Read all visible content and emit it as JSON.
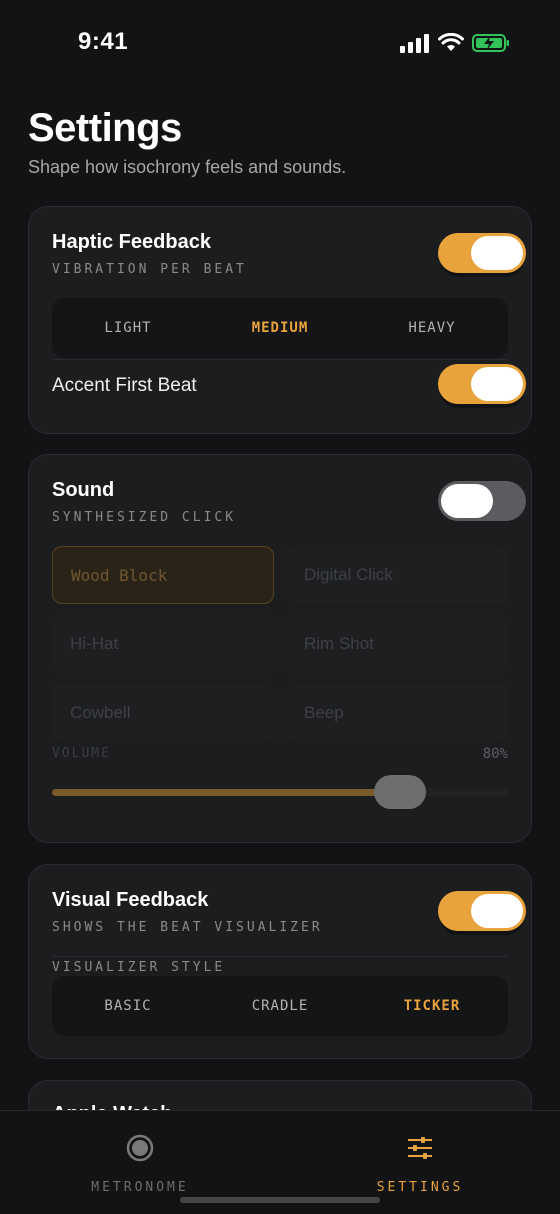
{
  "status": {
    "time": "9:41"
  },
  "header": {
    "title": "Settings",
    "subtitle": "Shape how isochrony feels and sounds."
  },
  "haptic": {
    "title": "Haptic Feedback",
    "caption": "VIBRATION PER BEAT",
    "enabled": true,
    "options": [
      "LIGHT",
      "MEDIUM",
      "HEAVY"
    ],
    "selected": "MEDIUM",
    "accent_label": "Accent First Beat",
    "accent_enabled": true
  },
  "sound": {
    "title": "Sound",
    "caption": "SYNTHESIZED CLICK",
    "enabled": false,
    "options": [
      "Wood Block",
      "Digital Click",
      "Hi-Hat",
      "Rim Shot",
      "Cowbell",
      "Beep"
    ],
    "selected": "Wood Block",
    "volume_label": "VOLUME",
    "volume_value": "80%",
    "volume": 0.8
  },
  "visual": {
    "title": "Visual Feedback",
    "caption": "SHOWS THE BEAT VISUALIZER",
    "enabled": true,
    "style_label": "VISUALIZER STYLE",
    "options": [
      "BASIC",
      "CRADLE",
      "TICKER"
    ],
    "selected": "TICKER"
  },
  "next_card": {
    "title": "Apple Watch"
  },
  "tabs": [
    {
      "label": "METRONOME",
      "icon": "metronome-icon",
      "active": false
    },
    {
      "label": "SETTINGS",
      "icon": "sliders-icon",
      "active": true
    }
  ],
  "colors": {
    "accent": "#e9a33c",
    "background": "#121314",
    "card": "#1b1d1f"
  }
}
